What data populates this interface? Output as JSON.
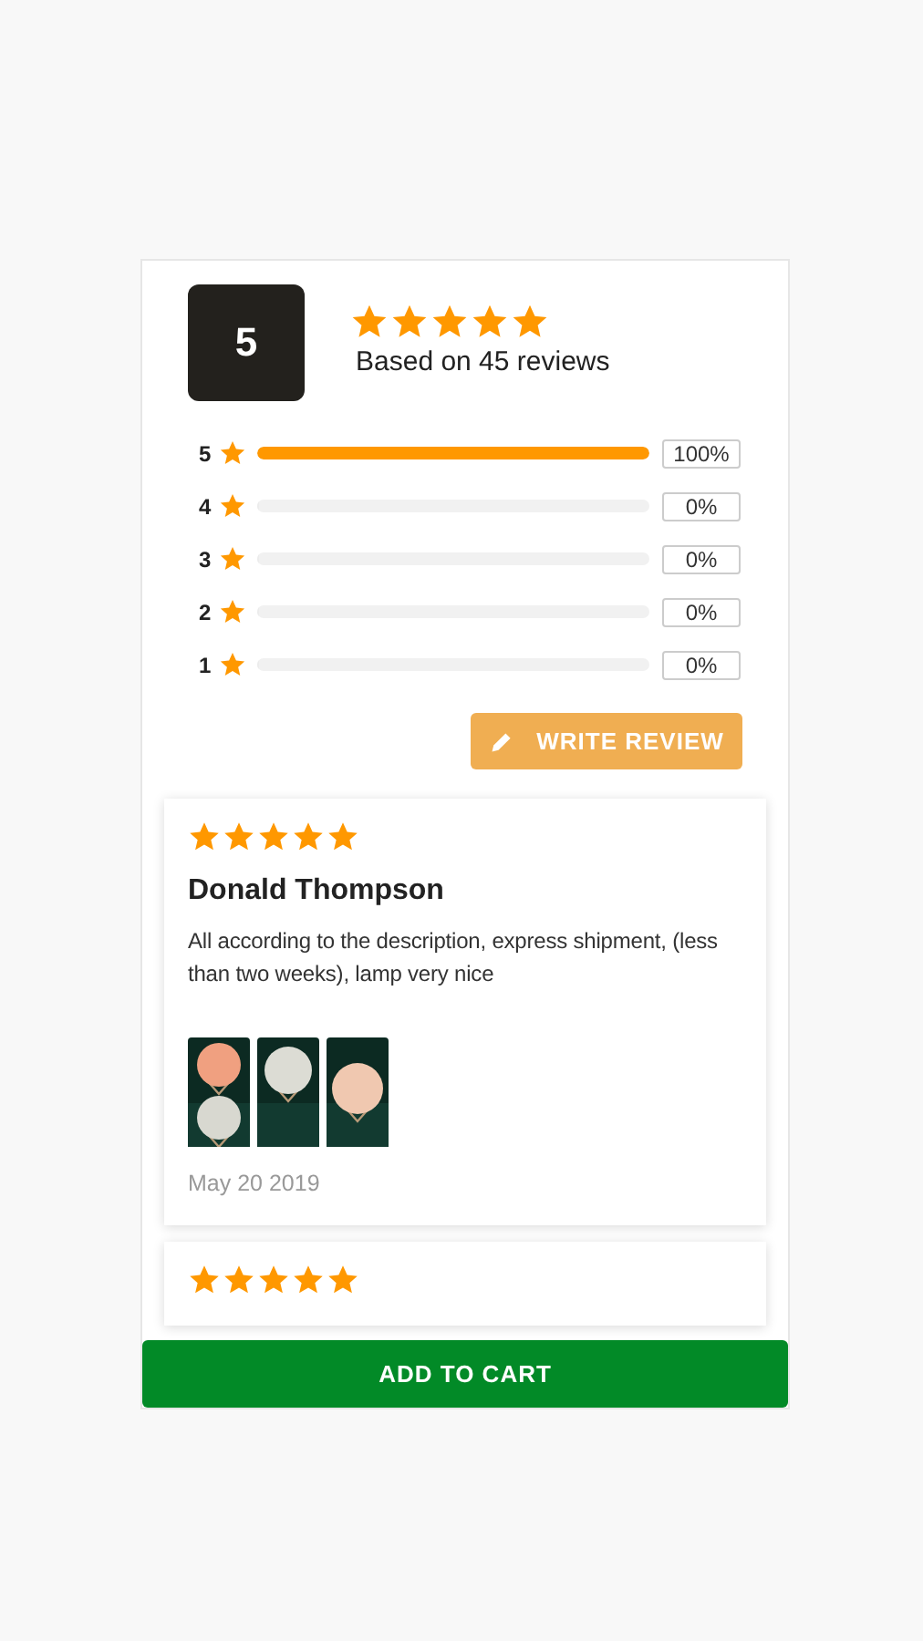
{
  "summary": {
    "score": "5",
    "stars": 5,
    "caption": "Based on 45 reviews"
  },
  "breakdown": [
    {
      "label": "5",
      "level": 1,
      "percent": "100%"
    },
    {
      "label": "4",
      "level": 0,
      "percent": "0%"
    },
    {
      "label": "3",
      "level": 0,
      "percent": "0%"
    },
    {
      "label": "2",
      "level": 0,
      "percent": "0%"
    },
    {
      "label": "1",
      "level": 0,
      "percent": "0%"
    }
  ],
  "write_review_button": "WRITE REVIEW",
  "reviews": [
    {
      "stars": 5,
      "name": "Donald Thompson",
      "text": "All according to the description, express shipment, (less than two weeks), lamp very nice",
      "photos": [
        {
          "kind": "picture"
        },
        {
          "kind": "picture"
        },
        {
          "kind": "picture"
        }
      ],
      "date": "May 20 2019"
    },
    {
      "stars": 5
    }
  ],
  "add_to_cart_button": "ADD TO CART"
}
